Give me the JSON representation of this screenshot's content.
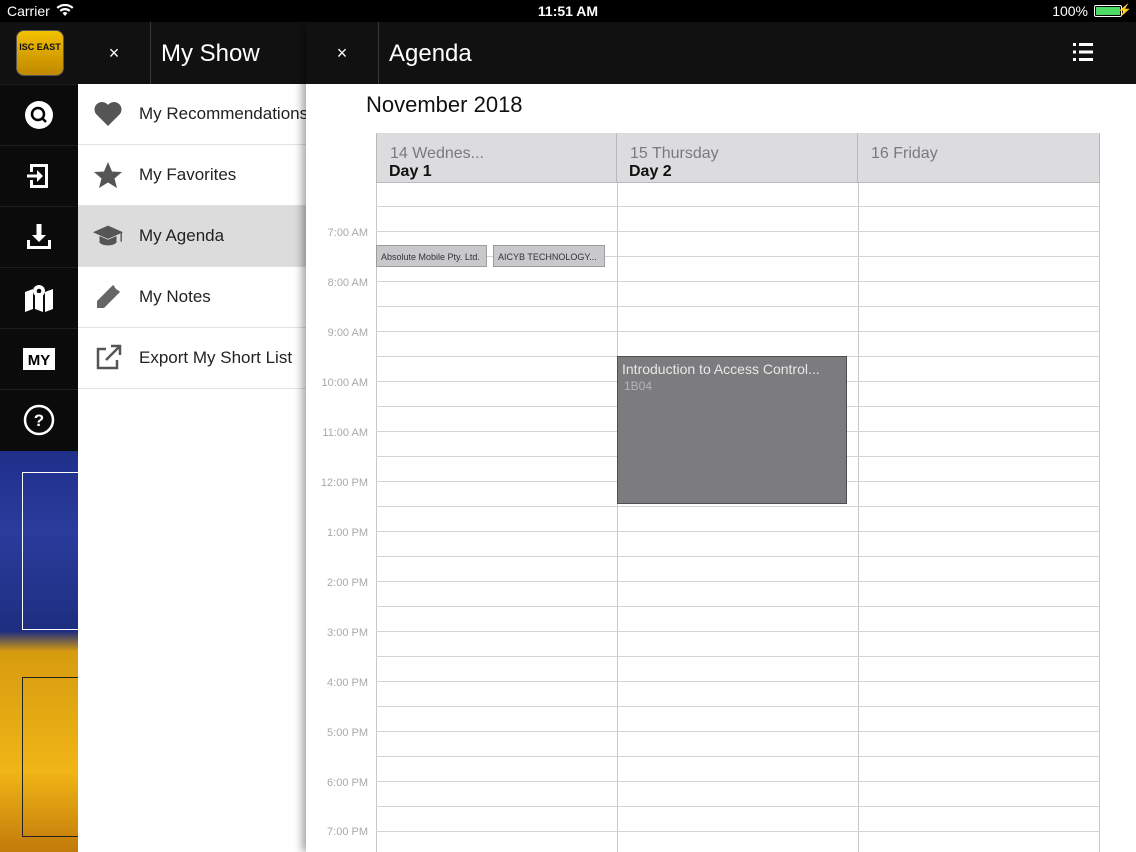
{
  "status_bar": {
    "carrier": "Carrier",
    "time": "11:51 AM",
    "battery": "100%"
  },
  "rail": {
    "logo_text": "ISC EAST",
    "items": [
      {
        "icon": "search-icon"
      },
      {
        "icon": "sign-in-icon"
      },
      {
        "icon": "download-icon"
      },
      {
        "icon": "map-icon"
      },
      {
        "icon": "my-icon",
        "label": "MY"
      },
      {
        "icon": "help-icon",
        "label": "?"
      }
    ]
  },
  "my_show": {
    "close_label": "×",
    "title": "My Show",
    "items": [
      {
        "label": "My Recommendations",
        "icon": "heart-icon"
      },
      {
        "label": "My Favorites",
        "icon": "star-icon"
      },
      {
        "label": "My Agenda",
        "icon": "graduation-cap-icon",
        "active": true
      },
      {
        "label": "My Notes",
        "icon": "pencil-icon"
      },
      {
        "label": "Export My Short List",
        "icon": "export-icon"
      }
    ]
  },
  "agenda": {
    "close_label": "×",
    "title": "Agenda",
    "month": "November 2018",
    "days": [
      {
        "name": "14 Wednes...",
        "day": "Day 1"
      },
      {
        "name": "15 Thursday",
        "day": "Day 2"
      },
      {
        "name": "16 Friday",
        "day": ""
      }
    ],
    "times": [
      "7:00 AM",
      "8:00 AM",
      "9:00 AM",
      "10:00 AM",
      "11:00 AM",
      "12:00 PM",
      "1:00 PM",
      "2:00 PM",
      "3:00 PM",
      "4:00 PM",
      "5:00 PM",
      "6:00 PM",
      "7:00 PM"
    ],
    "events": [
      {
        "title": "Absolute Mobile Pty. Ltd."
      },
      {
        "title": "AICYB TECHNOLOGY..."
      },
      {
        "title": "Introduction to Access Control...",
        "room": "1B04"
      }
    ]
  }
}
